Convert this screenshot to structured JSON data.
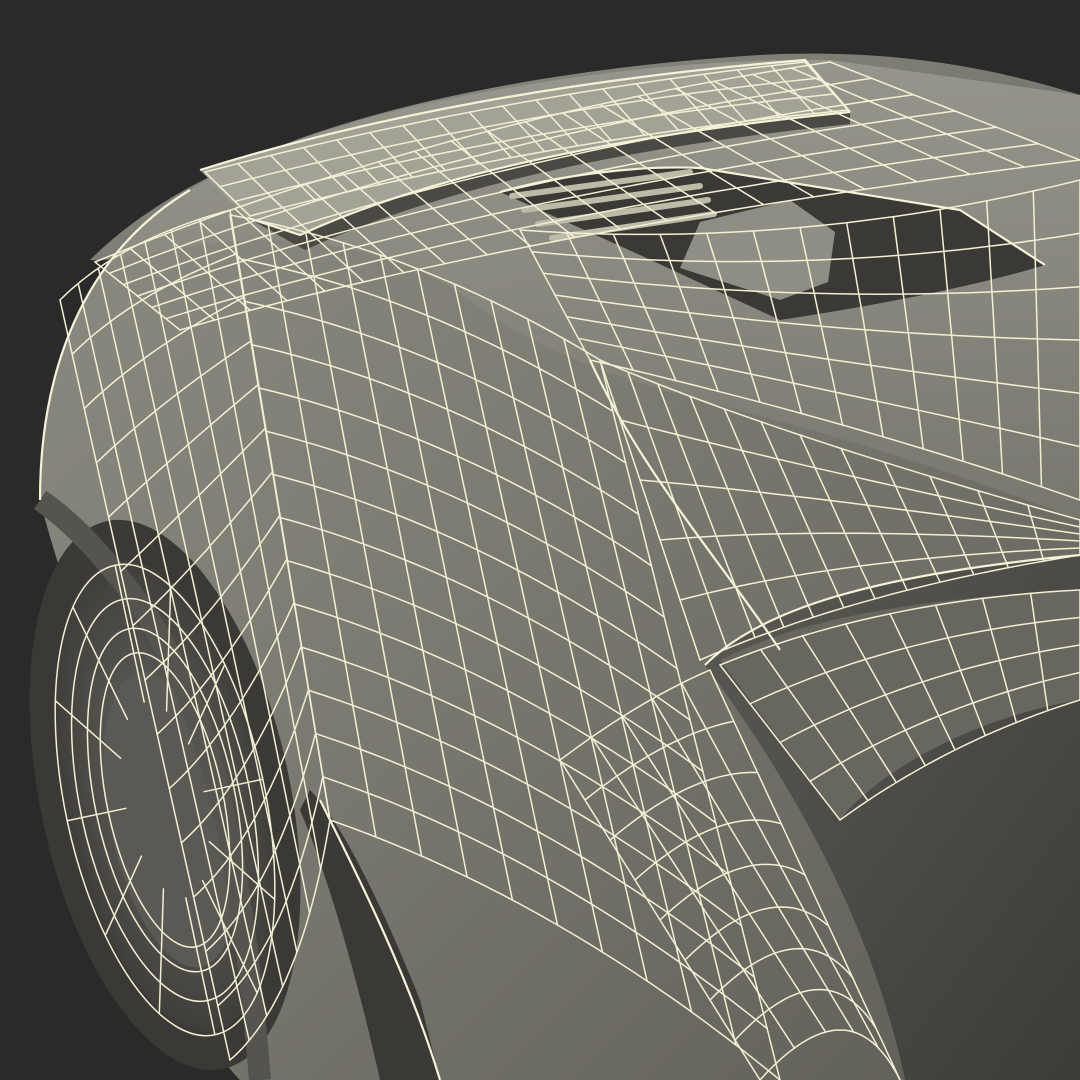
{
  "scene": {
    "subject": "car-rear-wireframe",
    "colors": {
      "background": "#2a2a2a",
      "surface": "#7d7c73",
      "surface_light": "#9a998f",
      "surface_dark": "#4f4e48",
      "shadow": "#1c1c1c",
      "wire": "#f3efd4"
    }
  }
}
